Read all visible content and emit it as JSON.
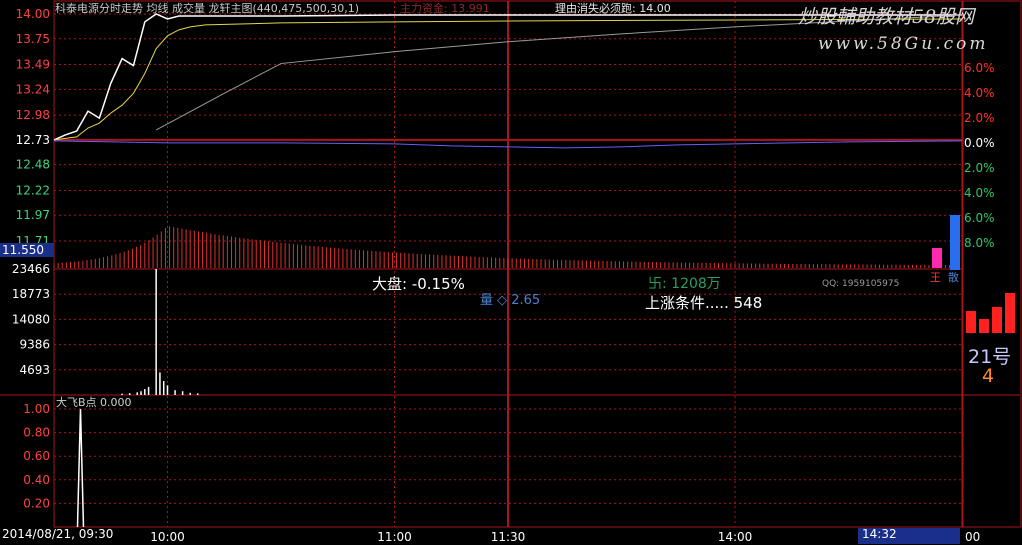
{
  "header": {
    "title": "科泰电源分时走势 均线 成交量 龙轩主图(440,475,500,30,1)",
    "main_funds": "主力资金: 13.991",
    "reason": "理由消失必须跑: 14.00"
  },
  "watermark": {
    "line1": "炒股輔助教材58股网",
    "line2": "www.58Gu.com"
  },
  "overlay_text": {
    "dapan": "大盘: -0.15%",
    "liang": "量 ◇ 2.65",
    "shangzhang": "上涨条件..... 548",
    "wan": "卐: 1208万",
    "qq": "QQ: 1959105975",
    "dafei": "大飞B点 0.000",
    "hao": "21号",
    "four": "4",
    "wang": "王",
    "san": "散"
  },
  "status": {
    "date_time": "2014/08/21, 09:30",
    "last_time": "14:32",
    "right_time": "00"
  },
  "colors": {
    "grid": "#a8161b",
    "price_line": "#ffffff",
    "avg_line": "#e8d44a",
    "index_line": "#6a5cff",
    "long_ma": "#9a9a9a",
    "volume_bar": "#ffffff",
    "osc_bar": "#e03030",
    "right_percent_red": "#ff3030",
    "right_percent_green": "#2ec76a"
  },
  "chart_data": [
    {
      "type": "line",
      "name_tag": "price",
      "y_ticks": [
        "14.00",
        "13.75",
        "13.49",
        "13.24",
        "12.98",
        "12.73",
        "12.48",
        "12.22",
        "11.97",
        "11.71"
      ],
      "y_range": [
        11.71,
        14.0
      ],
      "prev_close": 12.73,
      "right_ticks": [
        "6.0%",
        "4.0%",
        "2.0%",
        "0.0%",
        "2.0%",
        "4.0%",
        "6.0%",
        "8.0%"
      ],
      "left_marker": "11.550",
      "x_ticks": [
        "10:00",
        "11:00",
        "11:30",
        "14:00"
      ],
      "x_range_minutes": [
        0,
        240
      ],
      "series": [
        {
          "role": "price",
          "x": [
            0,
            3,
            6,
            9,
            12,
            15,
            18,
            21,
            24,
            27,
            30,
            33,
            36,
            40,
            45,
            60,
            90,
            120,
            150,
            180,
            210,
            225,
            240
          ],
          "y": [
            12.73,
            12.78,
            12.82,
            13.02,
            12.95,
            13.3,
            13.55,
            13.48,
            13.92,
            14.0,
            13.95,
            13.98,
            13.98,
            13.98,
            13.98,
            13.98,
            13.99,
            13.99,
            13.99,
            13.99,
            13.99,
            13.99,
            13.99
          ]
        },
        {
          "role": "average",
          "x": [
            0,
            6,
            9,
            12,
            15,
            18,
            21,
            24,
            27,
            30,
            33,
            36,
            40,
            60,
            120,
            180,
            240
          ],
          "y": [
            12.73,
            12.76,
            12.85,
            12.9,
            13.0,
            13.08,
            13.2,
            13.4,
            13.65,
            13.78,
            13.84,
            13.87,
            13.89,
            13.91,
            13.93,
            13.94,
            13.95
          ]
        },
        {
          "role": "index",
          "x": [
            0,
            30,
            60,
            90,
            105,
            120,
            135,
            150,
            165,
            180,
            210,
            240
          ],
          "y": [
            12.72,
            12.7,
            12.7,
            12.69,
            12.67,
            12.66,
            12.65,
            12.66,
            12.68,
            12.69,
            12.71,
            12.72
          ]
        },
        {
          "role": "long_ma",
          "x": [
            27,
            45,
            60,
            90,
            120,
            150,
            180,
            210,
            240
          ],
          "y": [
            12.83,
            13.2,
            13.5,
            13.62,
            13.72,
            13.8,
            13.87,
            13.93,
            13.99
          ]
        }
      ]
    },
    {
      "type": "bar",
      "name_tag": "oscillator",
      "bins": 220,
      "peak_minute": 30,
      "peak_value": 1.0,
      "decay": 0.018
    },
    {
      "type": "bar",
      "name_tag": "volume",
      "y_ticks": [
        "23466",
        "18773",
        "14080",
        "9386",
        "4693"
      ],
      "y_range": [
        0,
        23466
      ],
      "bars": [
        {
          "x": 27,
          "v": 23466
        },
        {
          "x": 28,
          "v": 4200
        },
        {
          "x": 29,
          "v": 2600
        },
        {
          "x": 30,
          "v": 1800
        },
        {
          "x": 25,
          "v": 1500
        },
        {
          "x": 24,
          "v": 1100
        },
        {
          "x": 23,
          "v": 700
        },
        {
          "x": 22,
          "v": 500
        },
        {
          "x": 32,
          "v": 900
        },
        {
          "x": 34,
          "v": 700
        },
        {
          "x": 36,
          "v": 400
        },
        {
          "x": 38,
          "v": 300
        },
        {
          "x": 20,
          "v": 350
        },
        {
          "x": 18,
          "v": 250
        }
      ]
    },
    {
      "type": "line",
      "name_tag": "dafei_b",
      "y_ticks": [
        "1.00",
        "0.80",
        "0.60",
        "0.40",
        "0.20"
      ],
      "y_range": [
        0,
        1.0
      ],
      "spike_minute": 7,
      "spike_value": 1.0
    }
  ],
  "right_panel_bars": [
    {
      "label": "r1",
      "value": 0.55
    },
    {
      "label": "r2",
      "value": 0.35
    },
    {
      "label": "r3",
      "value": 0.65
    },
    {
      "label": "r4",
      "value": 1.0
    }
  ]
}
